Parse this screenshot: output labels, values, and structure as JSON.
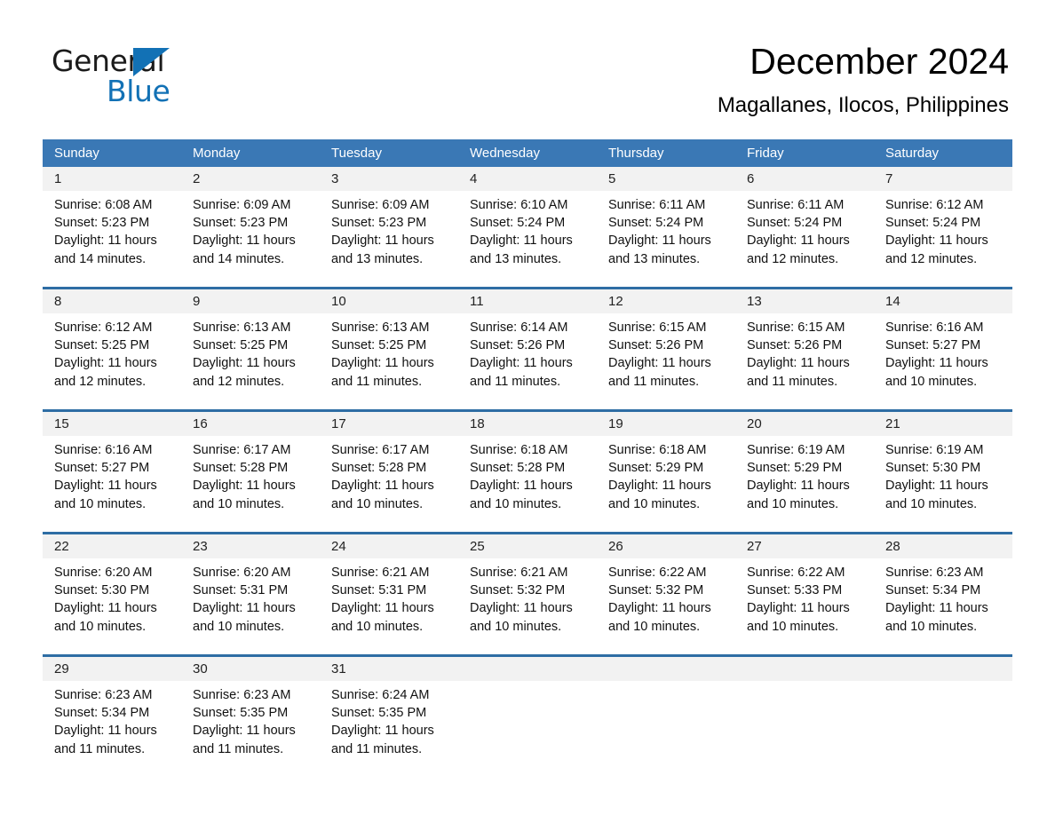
{
  "brand": {
    "line1": "General",
    "line2": "Blue",
    "triangle_color": "#1271b5",
    "text_color": "#1b1b1b"
  },
  "header": {
    "title": "December 2024",
    "subtitle": "Magallanes, Ilocos, Philippines"
  },
  "colors": {
    "header_row_bg": "#3a78b5",
    "week_divider": "#2e6da4",
    "day_number_bg": "#f2f2f2",
    "page_bg": "#ffffff",
    "text": "#111111"
  },
  "calendar": {
    "day_headers": [
      "Sunday",
      "Monday",
      "Tuesday",
      "Wednesday",
      "Thursday",
      "Friday",
      "Saturday"
    ],
    "weeks": [
      {
        "days": [
          {
            "n": "1",
            "l1": "Sunrise: 6:08 AM",
            "l2": "Sunset: 5:23 PM",
            "l3": "Daylight: 11 hours",
            "l4": "and 14 minutes."
          },
          {
            "n": "2",
            "l1": "Sunrise: 6:09 AM",
            "l2": "Sunset: 5:23 PM",
            "l3": "Daylight: 11 hours",
            "l4": "and 14 minutes."
          },
          {
            "n": "3",
            "l1": "Sunrise: 6:09 AM",
            "l2": "Sunset: 5:23 PM",
            "l3": "Daylight: 11 hours",
            "l4": "and 13 minutes."
          },
          {
            "n": "4",
            "l1": "Sunrise: 6:10 AM",
            "l2": "Sunset: 5:24 PM",
            "l3": "Daylight: 11 hours",
            "l4": "and 13 minutes."
          },
          {
            "n": "5",
            "l1": "Sunrise: 6:11 AM",
            "l2": "Sunset: 5:24 PM",
            "l3": "Daylight: 11 hours",
            "l4": "and 13 minutes."
          },
          {
            "n": "6",
            "l1": "Sunrise: 6:11 AM",
            "l2": "Sunset: 5:24 PM",
            "l3": "Daylight: 11 hours",
            "l4": "and 12 minutes."
          },
          {
            "n": "7",
            "l1": "Sunrise: 6:12 AM",
            "l2": "Sunset: 5:24 PM",
            "l3": "Daylight: 11 hours",
            "l4": "and 12 minutes."
          }
        ]
      },
      {
        "days": [
          {
            "n": "8",
            "l1": "Sunrise: 6:12 AM",
            "l2": "Sunset: 5:25 PM",
            "l3": "Daylight: 11 hours",
            "l4": "and 12 minutes."
          },
          {
            "n": "9",
            "l1": "Sunrise: 6:13 AM",
            "l2": "Sunset: 5:25 PM",
            "l3": "Daylight: 11 hours",
            "l4": "and 12 minutes."
          },
          {
            "n": "10",
            "l1": "Sunrise: 6:13 AM",
            "l2": "Sunset: 5:25 PM",
            "l3": "Daylight: 11 hours",
            "l4": "and 11 minutes."
          },
          {
            "n": "11",
            "l1": "Sunrise: 6:14 AM",
            "l2": "Sunset: 5:26 PM",
            "l3": "Daylight: 11 hours",
            "l4": "and 11 minutes."
          },
          {
            "n": "12",
            "l1": "Sunrise: 6:15 AM",
            "l2": "Sunset: 5:26 PM",
            "l3": "Daylight: 11 hours",
            "l4": "and 11 minutes."
          },
          {
            "n": "13",
            "l1": "Sunrise: 6:15 AM",
            "l2": "Sunset: 5:26 PM",
            "l3": "Daylight: 11 hours",
            "l4": "and 11 minutes."
          },
          {
            "n": "14",
            "l1": "Sunrise: 6:16 AM",
            "l2": "Sunset: 5:27 PM",
            "l3": "Daylight: 11 hours",
            "l4": "and 10 minutes."
          }
        ]
      },
      {
        "days": [
          {
            "n": "15",
            "l1": "Sunrise: 6:16 AM",
            "l2": "Sunset: 5:27 PM",
            "l3": "Daylight: 11 hours",
            "l4": "and 10 minutes."
          },
          {
            "n": "16",
            "l1": "Sunrise: 6:17 AM",
            "l2": "Sunset: 5:28 PM",
            "l3": "Daylight: 11 hours",
            "l4": "and 10 minutes."
          },
          {
            "n": "17",
            "l1": "Sunrise: 6:17 AM",
            "l2": "Sunset: 5:28 PM",
            "l3": "Daylight: 11 hours",
            "l4": "and 10 minutes."
          },
          {
            "n": "18",
            "l1": "Sunrise: 6:18 AM",
            "l2": "Sunset: 5:28 PM",
            "l3": "Daylight: 11 hours",
            "l4": "and 10 minutes."
          },
          {
            "n": "19",
            "l1": "Sunrise: 6:18 AM",
            "l2": "Sunset: 5:29 PM",
            "l3": "Daylight: 11 hours",
            "l4": "and 10 minutes."
          },
          {
            "n": "20",
            "l1": "Sunrise: 6:19 AM",
            "l2": "Sunset: 5:29 PM",
            "l3": "Daylight: 11 hours",
            "l4": "and 10 minutes."
          },
          {
            "n": "21",
            "l1": "Sunrise: 6:19 AM",
            "l2": "Sunset: 5:30 PM",
            "l3": "Daylight: 11 hours",
            "l4": "and 10 minutes."
          }
        ]
      },
      {
        "days": [
          {
            "n": "22",
            "l1": "Sunrise: 6:20 AM",
            "l2": "Sunset: 5:30 PM",
            "l3": "Daylight: 11 hours",
            "l4": "and 10 minutes."
          },
          {
            "n": "23",
            "l1": "Sunrise: 6:20 AM",
            "l2": "Sunset: 5:31 PM",
            "l3": "Daylight: 11 hours",
            "l4": "and 10 minutes."
          },
          {
            "n": "24",
            "l1": "Sunrise: 6:21 AM",
            "l2": "Sunset: 5:31 PM",
            "l3": "Daylight: 11 hours",
            "l4": "and 10 minutes."
          },
          {
            "n": "25",
            "l1": "Sunrise: 6:21 AM",
            "l2": "Sunset: 5:32 PM",
            "l3": "Daylight: 11 hours",
            "l4": "and 10 minutes."
          },
          {
            "n": "26",
            "l1": "Sunrise: 6:22 AM",
            "l2": "Sunset: 5:32 PM",
            "l3": "Daylight: 11 hours",
            "l4": "and 10 minutes."
          },
          {
            "n": "27",
            "l1": "Sunrise: 6:22 AM",
            "l2": "Sunset: 5:33 PM",
            "l3": "Daylight: 11 hours",
            "l4": "and 10 minutes."
          },
          {
            "n": "28",
            "l1": "Sunrise: 6:23 AM",
            "l2": "Sunset: 5:34 PM",
            "l3": "Daylight: 11 hours",
            "l4": "and 10 minutes."
          }
        ]
      },
      {
        "days": [
          {
            "n": "29",
            "l1": "Sunrise: 6:23 AM",
            "l2": "Sunset: 5:34 PM",
            "l3": "Daylight: 11 hours",
            "l4": "and 11 minutes."
          },
          {
            "n": "30",
            "l1": "Sunrise: 6:23 AM",
            "l2": "Sunset: 5:35 PM",
            "l3": "Daylight: 11 hours",
            "l4": "and 11 minutes."
          },
          {
            "n": "31",
            "l1": "Sunrise: 6:24 AM",
            "l2": "Sunset: 5:35 PM",
            "l3": "Daylight: 11 hours",
            "l4": "and 11 minutes."
          },
          {
            "n": "",
            "l1": "",
            "l2": "",
            "l3": "",
            "l4": ""
          },
          {
            "n": "",
            "l1": "",
            "l2": "",
            "l3": "",
            "l4": ""
          },
          {
            "n": "",
            "l1": "",
            "l2": "",
            "l3": "",
            "l4": ""
          },
          {
            "n": "",
            "l1": "",
            "l2": "",
            "l3": "",
            "l4": ""
          }
        ]
      }
    ]
  }
}
